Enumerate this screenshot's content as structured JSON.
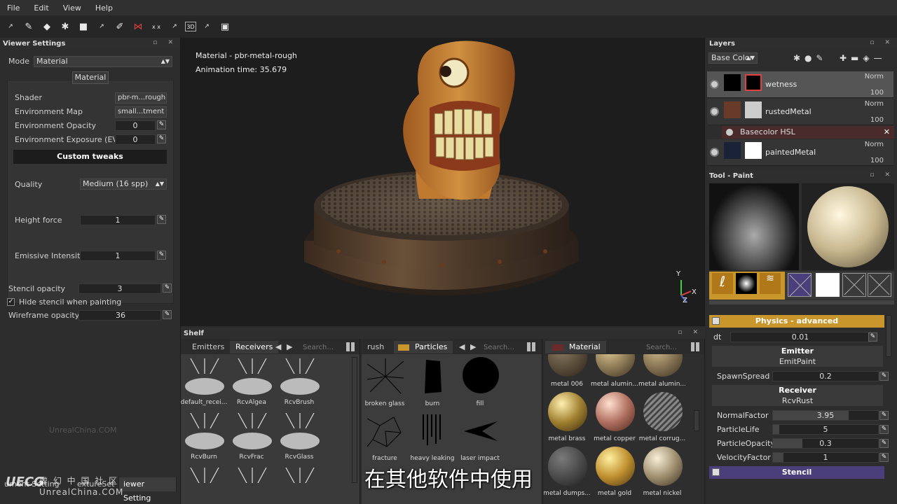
{
  "menu": [
    "File",
    "Edit",
    "View",
    "Help"
  ],
  "toolbar_icons": [
    "export-icon",
    "brush-icon",
    "eraser-icon",
    "particle-icon",
    "projection-icon",
    "export-icon",
    "eyedropper-icon",
    "symmetry-icon",
    "symmetry-xx-icon",
    "export-icon",
    "3d-icon",
    "export-icon",
    "camera-icon"
  ],
  "toolbar_labels": {
    "xx": "x x",
    "three_d": "3D"
  },
  "left": {
    "title": "Viewer Settings",
    "mode_label": "Mode",
    "mode_value": "Material",
    "material_button": "Material",
    "shader_label": "Shader",
    "shader_value": "pbr-m...rough",
    "envmap_label": "Environment Map",
    "envmap_value": "small...tment",
    "envopacity_label": "Environment Opacity",
    "envopacity_value": "0",
    "envexposure_label": "Environment Exposure (EV)",
    "envexposure_value": "0",
    "custom_tweaks": "Custom tweaks",
    "quality_label": "Quality",
    "quality_value": "Medium (16 spp)",
    "height_label": "Height force",
    "height_value": "1",
    "emissive_label": "Emissive Intensity",
    "emissive_value": "1",
    "stencil_label": "Stencil opacity",
    "stencil_value": "3",
    "hide_stencil_label": "Hide stencil when painting",
    "hide_stencil_checked": true,
    "wireframe_label": "Wireframe opacity",
    "wireframe_value": "36",
    "tabs": [
      "ument Setting",
      "extureSet",
      "iewer Setting"
    ]
  },
  "viewport": {
    "material_text": "Material - pbr-metal-rough",
    "anim_text": "Animation time: 35.679",
    "axis_y": "Y",
    "axis_x": "X",
    "axis_z": "Z"
  },
  "shelf": {
    "title": "Shelf",
    "col1": {
      "tabs": [
        "Emitters",
        "Receivers"
      ],
      "search": "Search...",
      "items": [
        "default_recei...",
        "RcvAlgea",
        "RcvBrush",
        "RcvBurn",
        "RcvFrac",
        "RcvGlass",
        "",
        "",
        ""
      ]
    },
    "col2": {
      "tabs": [
        "rush",
        "Particles"
      ],
      "search": "Search...",
      "items": [
        "broken glass",
        "burn",
        "fill",
        "fracture",
        "heavy leaking",
        "laser impact"
      ]
    },
    "col3": {
      "tabs": [
        "Material"
      ],
      "search": "Search...",
      "items": [
        "metal 006",
        "metal alumin...",
        "metal alumin...",
        "metal brass",
        "metal copper",
        "metal corrug...",
        "metal dumps...",
        "metal gold",
        "metal nickel"
      ]
    }
  },
  "layers": {
    "title": "Layers",
    "channel": "Base Color",
    "items": [
      {
        "name": "wetness",
        "mode": "Norm",
        "opacity": "100"
      },
      {
        "name": "rustedMetal",
        "mode": "Norm",
        "opacity": "100"
      },
      {
        "name": "paintedMetal",
        "mode": "Norm",
        "opacity": "100"
      }
    ],
    "effect": "Basecolor HSL"
  },
  "tool": {
    "title": "Tool - Paint",
    "slots": [
      "brush",
      "alpha",
      "physics",
      "stencil",
      "color",
      "height",
      "smooth"
    ],
    "physics_header": "Physics - advanced",
    "dt_label": "dt",
    "dt_value": "0.01",
    "emitter_header": "Emitter",
    "emitter_value": "EmitPaint",
    "spawn_label": "SpawnSpread",
    "spawn_value": "0.2",
    "receiver_header": "Receiver",
    "receiver_value": "RcvRust",
    "normal_label": "NormalFactor",
    "normal_value": "3.95",
    "life_label": "ParticleLife",
    "life_value": "5",
    "opacity_label": "ParticleOpacity",
    "opacity_value": "0.3",
    "velocity_label": "VelocityFactor",
    "velocity_value": "1",
    "stencil_header": "Stencil"
  },
  "subtitle": "在其他软件中使用",
  "watermark": {
    "logo": "UECG",
    "cn": "虚 幻 中 国 社 区",
    "en": "UnrealChina.COM",
    "en_faint": "UnrealChina.COM"
  },
  "colors": {
    "accent_orange": "#c8962a",
    "accent_purple": "#4a3f7a",
    "layer_effect": "#4a2b2b"
  }
}
